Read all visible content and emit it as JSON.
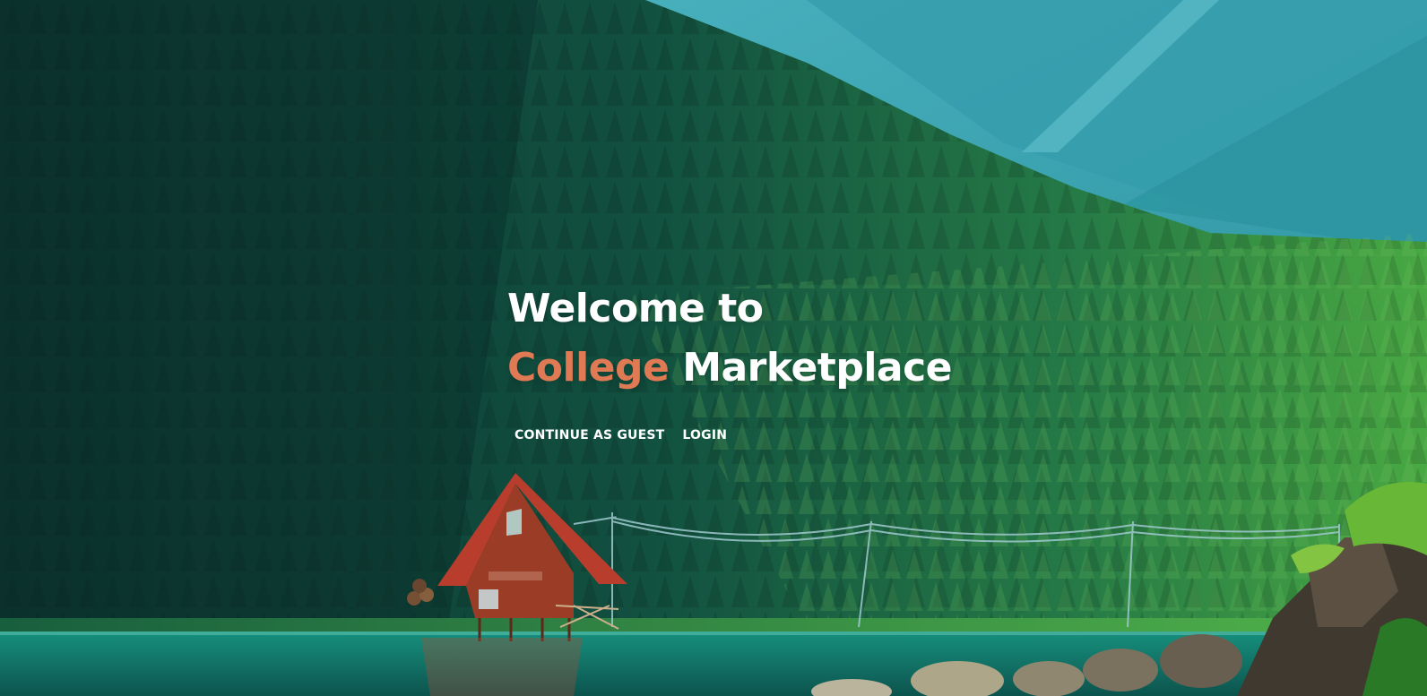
{
  "hero": {
    "line1": "Welcome to",
    "accent_word": "College",
    "rest_word": "Marketplace"
  },
  "actions": {
    "guest_label": "CONTINUE AS GUEST",
    "login_label": "LOGIN"
  },
  "colors": {
    "accent": "#e07a55",
    "text": "#ffffff",
    "forest_dark": "#0f3b37",
    "sky": "#4cc3d6",
    "water": "#2bbfa8",
    "cabin_roof": "#d9442f"
  },
  "background": {
    "scene": "forest-lake-cabin-illustration"
  }
}
